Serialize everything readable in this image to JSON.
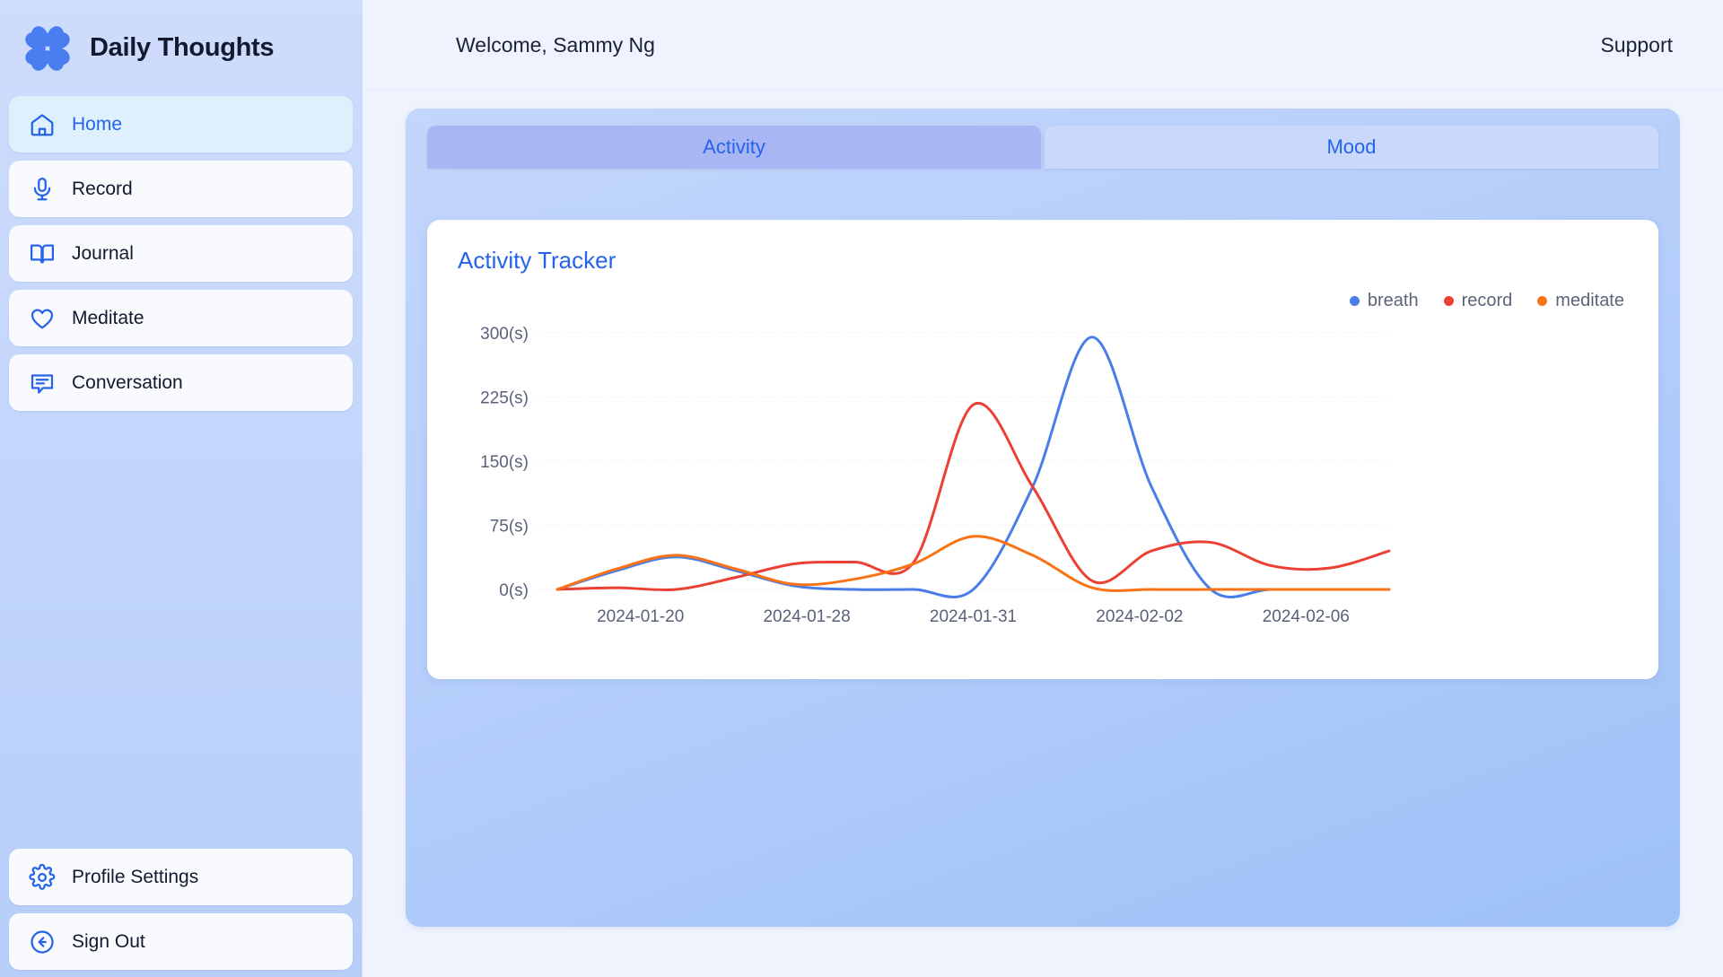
{
  "brand": {
    "title": "Daily Thoughts",
    "logo_icon": "clover-heart-logo",
    "color": "#4a7ef0"
  },
  "sidebar": {
    "items": [
      {
        "label": "Home",
        "icon": "home-icon",
        "active": true
      },
      {
        "label": "Record",
        "icon": "microphone-icon",
        "active": false
      },
      {
        "label": "Journal",
        "icon": "book-icon",
        "active": false
      },
      {
        "label": "Meditate",
        "icon": "heart-icon",
        "active": false
      },
      {
        "label": "Conversation",
        "icon": "chat-bubble-icon",
        "active": false
      }
    ],
    "bottom_items": [
      {
        "label": "Profile Settings",
        "icon": "gear-icon"
      },
      {
        "label": "Sign Out",
        "icon": "arrow-left-circle-icon"
      }
    ]
  },
  "topbar": {
    "welcome": "Welcome, Sammy Ng",
    "support": "Support"
  },
  "tabs": [
    {
      "label": "Activity",
      "active": true
    },
    {
      "label": "Mood",
      "active": false
    }
  ],
  "card": {
    "title": "Activity Tracker"
  },
  "chart_data": {
    "type": "line",
    "title": "Activity Tracker",
    "xlabel": "",
    "ylabel": "",
    "ylim": [
      0,
      300
    ],
    "grid": true,
    "legend_position": "top-right",
    "ytick_labels": [
      "0(s)",
      "75(s)",
      "150(s)",
      "225(s)",
      "300(s)"
    ],
    "ytick_values": [
      0,
      75,
      150,
      225,
      300
    ],
    "xtick_labels": [
      "2024-01-20",
      "2024-01-28",
      "2024-01-31",
      "2024-02-02",
      "2024-02-06"
    ],
    "x": [
      "2024-01-20",
      "2024-01-22",
      "2024-01-24",
      "2024-01-26",
      "2024-01-28",
      "2024-01-29",
      "2024-01-30",
      "2024-01-31",
      "2024-02-01",
      "2024-02-02",
      "2024-02-03",
      "2024-02-04",
      "2024-02-05",
      "2024-02-06",
      "2024-02-07"
    ],
    "series": [
      {
        "name": "breath",
        "color": "#4a7de8",
        "values": [
          0,
          22,
          38,
          22,
          4,
          0,
          0,
          0,
          120,
          295,
          120,
          0,
          0,
          0,
          0
        ]
      },
      {
        "name": "record",
        "color": "#ec4034",
        "values": [
          0,
          2,
          0,
          14,
          30,
          32,
          32,
          216,
          120,
          10,
          45,
          55,
          28,
          25,
          45
        ]
      },
      {
        "name": "meditate",
        "color": "#f97316",
        "values": [
          0,
          24,
          40,
          24,
          6,
          12,
          30,
          62,
          40,
          2,
          0,
          0,
          0,
          0,
          0
        ]
      }
    ]
  }
}
